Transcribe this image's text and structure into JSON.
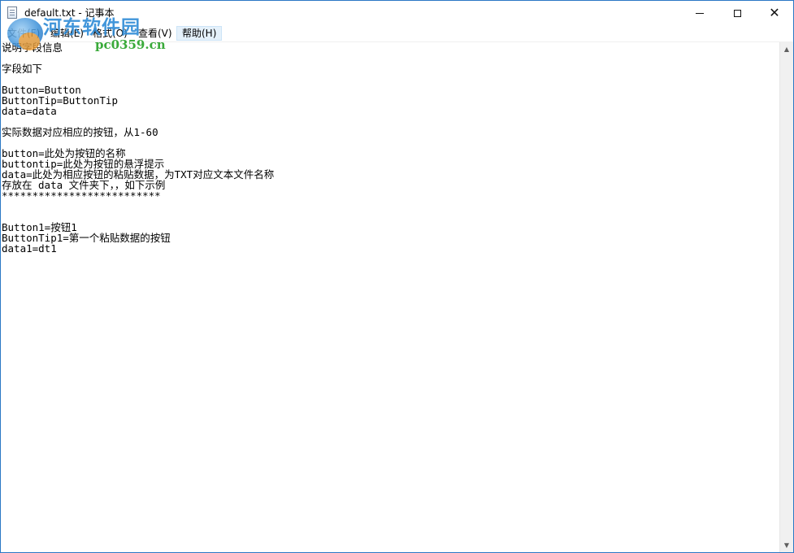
{
  "window": {
    "title": "default.txt - 记事本",
    "icon": "notepad-icon",
    "controls": {
      "minimize": "minimize-icon",
      "maximize": "maximize-icon",
      "close": "close-icon",
      "close_glyph": "✕"
    }
  },
  "menu": {
    "file": "文件(F)",
    "edit": "编辑(E)",
    "format": "格式(O)",
    "view": "查看(V)",
    "help": "帮助(H)"
  },
  "watermark": {
    "name": "河东软件园",
    "url": "pc0359.cn"
  },
  "editor": {
    "content": "说明字段信息\n\n字段如下\n\nButton=Button\nButtonTip=ButtonTip\ndata=data\n\n实际数据对应相应的按钮，从1-60\n\nbutton=此处为按钮的名称\nbuttontip=此处为按钮的悬浮提示\ndata=此处为相应按钮的粘贴数据，为TXT对应文本文件名称\n存放在 data 文件夹下，，如下示例\n**************************\n\n\nButton1=按钮1\nButtonTip1=第一个粘贴数据的按钮\ndata1=dt1"
  },
  "scrollbar": {
    "up": "▲",
    "down": "▼"
  }
}
